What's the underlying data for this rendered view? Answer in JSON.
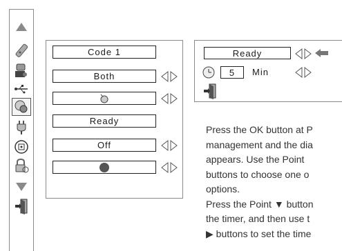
{
  "menu": {
    "fields": [
      {
        "label": "Code 1"
      },
      {
        "label": "Both"
      },
      {
        "label": ""
      },
      {
        "label": "Ready"
      },
      {
        "label": "Off"
      },
      {
        "label": ""
      }
    ]
  },
  "submenu": {
    "status": "Ready",
    "timer_value": "5",
    "timer_unit": "Min"
  },
  "description": {
    "lines": [
      "Press the OK button at P",
      "management and the dia",
      "appears.  Use the Point",
      "buttons to choose one o",
      "options.",
      "Press the Point ▼ button",
      "the timer, and then use t",
      "▶ buttons to set the time"
    ]
  },
  "icons": [
    "up-arrow-icon",
    "remote-icon",
    "projector-icon",
    "usb-icon",
    "power-management-icon",
    "plug-icon",
    "keypad-icon",
    "lock-icon",
    "down-arrow-icon",
    "exit-icon",
    "mouse-icon",
    "circle-icon",
    "clock-icon",
    "back-arrow-icon"
  ]
}
